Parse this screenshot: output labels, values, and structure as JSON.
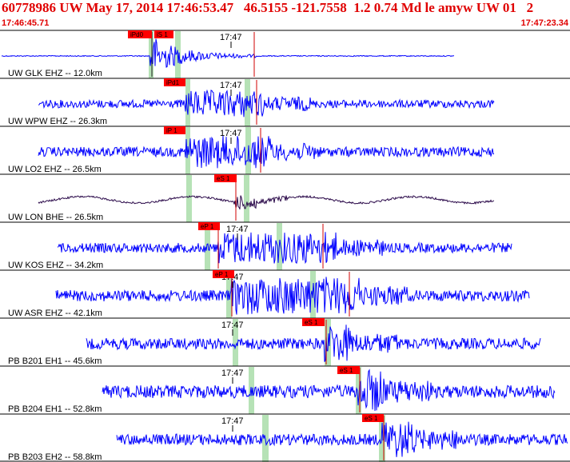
{
  "header": {
    "title": "60778986 UW May 17, 2014 17:46:53.47   46.5155 -121.7558  1.2 0.74 Md le amyw UW 01   2",
    "start_time": "17:46:45.71",
    "end_time": "17:47:23.34"
  },
  "colors": {
    "header_text": "#e00000",
    "trace": "#0000ff",
    "trace_broadband": "#2b0a4a",
    "pick_box": "#ff0000",
    "pick_line": "#e00000",
    "shade": "#b6e2b6",
    "separator": "#000000"
  },
  "minute_label": "17:47",
  "traces": [
    {
      "label": "UW GLK EHZ -- 12.0km",
      "picks": [
        "iPd0",
        "iS 1"
      ],
      "color": "blue"
    },
    {
      "label": "UW WPW EHZ -- 26.3km",
      "picks": [
        "iPd1"
      ],
      "color": "blue"
    },
    {
      "label": "UW LO2 EHZ -- 26.5km",
      "picks": [
        "iP 1"
      ],
      "color": "blue"
    },
    {
      "label": "UW LON BHE -- 26.5km",
      "picks": [
        "eS 1"
      ],
      "color": "broadband"
    },
    {
      "label": "UW KOS EHZ -- 34.2km",
      "picks": [
        "eP 1"
      ],
      "color": "blue"
    },
    {
      "label": "UW ASR EHZ -- 42.1km",
      "picks": [
        "eP 1"
      ],
      "color": "blue"
    },
    {
      "label": "PB B201 EH1 -- 45.6km",
      "picks": [
        "eS 1"
      ],
      "color": "blue"
    },
    {
      "label": "PB B204 EH1 -- 52.8km",
      "picks": [
        "eS 1"
      ],
      "color": "blue"
    },
    {
      "label": "PB B203 EH2 -- 58.8km",
      "picks": [
        "eS 1"
      ],
      "color": "blue"
    }
  ]
}
